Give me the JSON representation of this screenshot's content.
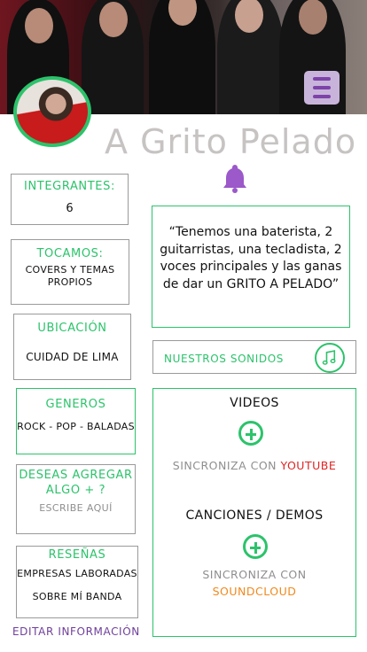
{
  "header": {
    "band_name": "A Grito Pelado",
    "menu_icon": "hamburger-menu-icon"
  },
  "profile": {
    "avatar_icon": "band-avatar"
  },
  "notification": {
    "icon": "bell-icon",
    "color": "#9b59c9"
  },
  "info": {
    "integrantes": {
      "label": "INTEGRANTES:",
      "value": "6"
    },
    "tocamos": {
      "label": "TOCAMOS:",
      "value_line1": "COVERS Y TEMAS",
      "value_line2": "PROPIOS"
    },
    "ubicacion": {
      "label": "UBICACIÓN",
      "value": "CUIDAD DE LIMA"
    },
    "generos": {
      "label": "GENEROS",
      "value": "ROCK - POP - BALADAS"
    },
    "agregar": {
      "label_line1": "DESEAS AGREGAR",
      "label_line2": "ALGO + ?",
      "placeholder": "ESCRIBE AQUÍ"
    },
    "resenas": {
      "label": "RESEÑAS",
      "value_line1": "EMPRESAS LABORADAS",
      "value_line2": "SOBRE MÍ BANDA"
    }
  },
  "quote": {
    "text": "“Tenemos una baterista, 2 guitarristas, una tecladista, 2 voces principales y las ganas de dar un GRITO A PELADO”"
  },
  "sounds": {
    "label": "NUESTROS SONIDOS",
    "icon": "music-note-icon"
  },
  "media": {
    "videos_title": "VIDEOS",
    "videos_sync_prefix": "SINCRONIZA CON ",
    "videos_service": "YOUTUBE",
    "songs_title": "CANCIONES / DEMOS",
    "songs_sync_prefix": "SINCRONIZA CON",
    "songs_service": "SOUNDCLOUD"
  },
  "footer": {
    "edit_label": "EDITAR INFORMACIÓN"
  },
  "colors": {
    "accent_green": "#2cc36b",
    "purple": "#6f3f9b",
    "youtube_red": "#e02424",
    "soundcloud_orange": "#f0891f",
    "name_gray": "#c7c3c3"
  }
}
